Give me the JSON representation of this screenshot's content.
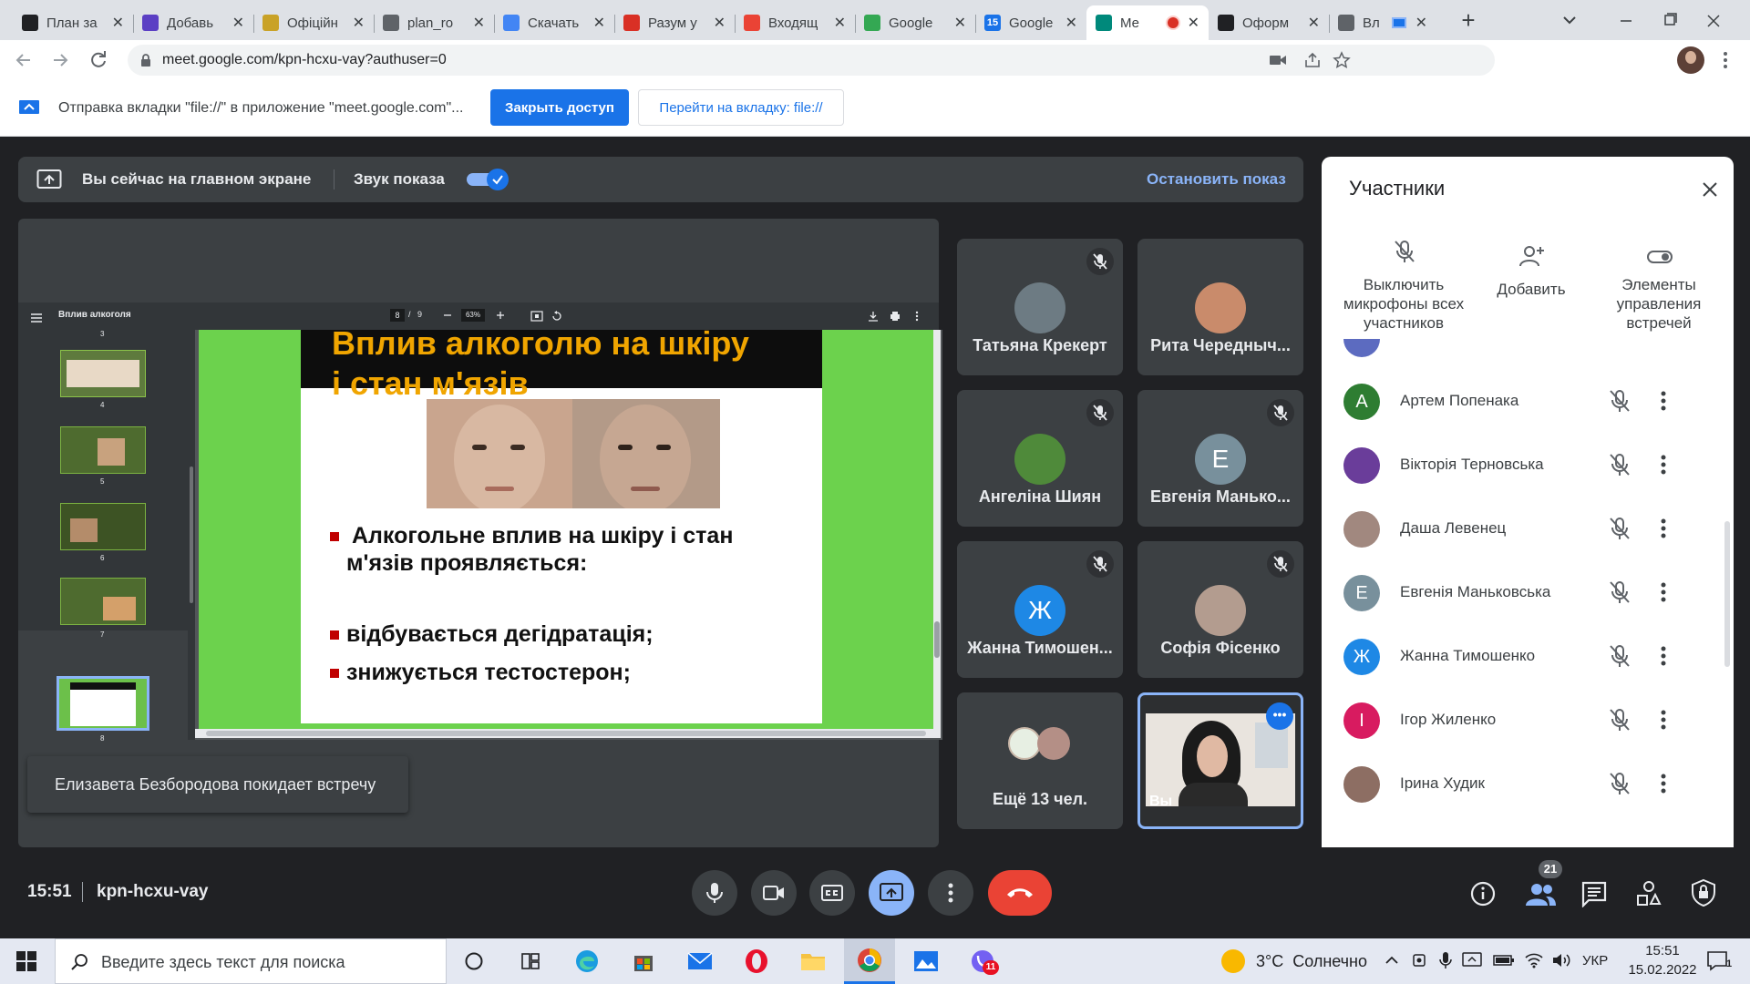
{
  "tabs": [
    {
      "title": "План за",
      "color": "#202124",
      "icon": "graduation-cap-icon"
    },
    {
      "title": "Добавь",
      "color": "#5b3fc4",
      "icon": "shield-icon"
    },
    {
      "title": "Офіційн",
      "color": "#c9a227",
      "icon": "coat-of-arms-icon"
    },
    {
      "title": "plan_ro",
      "color": "#5f6368",
      "icon": "globe-icon"
    },
    {
      "title": "Скачать",
      "color": "#4285f4",
      "icon": "download-icon"
    },
    {
      "title": "Разум у",
      "color": "#d93025",
      "icon": "bookmark-icon"
    },
    {
      "title": "Входящ",
      "color": "#ea4335",
      "icon": "gmail-icon"
    },
    {
      "title": "Google",
      "color": "#34a853",
      "icon": "google-classroom-icon"
    },
    {
      "title": "Google",
      "color": "#1a73e8",
      "icon": "calendar-icon"
    },
    {
      "title": "Ме",
      "color": "#00897b",
      "icon": "meet-icon"
    },
    {
      "title": "Оформ",
      "color": "#202124",
      "icon": "u-logo-icon"
    },
    {
      "title": "Вл",
      "color": "#5f6368",
      "icon": "globe-icon"
    }
  ],
  "calendar_badge": "15",
  "new_tab_glyph": "+",
  "url": "meet.google.com/kpn-hcxu-vay?authuser=0",
  "infobar": {
    "message": "Отправка вкладки \"file://\" в приложение \"meet.google.com\"...",
    "stop_label": "Закрыть доступ",
    "goto_label": "Перейти на вкладку: file://"
  },
  "present_bar": {
    "main_screen_text": "Вы сейчас на главном экране",
    "sound_label": "Звук показа",
    "sound_on": true,
    "stop_label": "Остановить показ"
  },
  "pdf": {
    "doc_title": "Вплив алкоголя",
    "page_current": "8",
    "page_sep": "/",
    "page_total": "9",
    "zoom": "63%",
    "thumb_numbers": [
      "3",
      "4",
      "5",
      "6",
      "7",
      "8"
    ],
    "slide_title_line1": "Вплив алкоголю  на шкіру",
    "slide_title_line2": "і стан м'язів",
    "bullet1_line1": "Алкогольне вплив на шкіру і стан",
    "bullet1_line2": "м'язів проявляється:",
    "bullet2": "відбувається дегідратація;",
    "bullet3": "знижується тестостерон;"
  },
  "toast": "Елизавета Безбородова покидает встречу",
  "tiles": [
    {
      "name": "Татьяна Крекерт",
      "muted": true,
      "avatar_color": "#6d7b83",
      "initial": ""
    },
    {
      "name": "Рита Чередныч...",
      "muted": false,
      "avatar_color": "#c98b6b",
      "initial": ""
    },
    {
      "name": "Ангеліна Шиян",
      "muted": true,
      "avatar_color": "#4f8a3a",
      "initial": ""
    },
    {
      "name": "Евгенія Манько...",
      "muted": true,
      "avatar_color": "#78909c",
      "initial": "Е"
    },
    {
      "name": "Жанна Тимошен...",
      "muted": true,
      "avatar_color": "#1e88e5",
      "initial": "Ж"
    },
    {
      "name": "Софія Фісенко",
      "muted": true,
      "avatar_color": "#b39c8f",
      "initial": ""
    },
    {
      "name": "Ещё 13 чел.",
      "muted": false,
      "avatar_color": "#5f6368",
      "initial": ""
    },
    {
      "name": "Вы",
      "muted": false,
      "avatar_color": "#3c3c3c",
      "initial": ""
    }
  ],
  "panel": {
    "title": "Участники",
    "actions": [
      {
        "label": "Выключить микрофоны всех участников",
        "icon": "mic-off-icon"
      },
      {
        "label": "Добавить",
        "icon": "add-person-icon"
      },
      {
        "label": "Элементы управления встречей",
        "icon": "toggle-icon"
      }
    ],
    "people": [
      {
        "name": "Артем Попенака",
        "initial": "А",
        "color": "#2e7d32"
      },
      {
        "name": "Вікторія Терновська",
        "initial": "",
        "color": "#6a3d9a"
      },
      {
        "name": "Даша Левенец",
        "initial": "",
        "color": "#a1887f"
      },
      {
        "name": "Евгенія Маньковська",
        "initial": "Е",
        "color": "#78909c"
      },
      {
        "name": "Жанна Тимошенко",
        "initial": "Ж",
        "color": "#1e88e5"
      },
      {
        "name": "Ігор Жиленко",
        "initial": "І",
        "color": "#d81b60"
      },
      {
        "name": "Ірина Худик",
        "initial": "",
        "color": "#8d6e63"
      }
    ]
  },
  "bottom": {
    "time": "15:51",
    "meeting_code": "kpn-hcxu-vay",
    "participants_count": "21"
  },
  "taskbar": {
    "search_placeholder": "Введите здесь текст для поиска",
    "weather": "3°C  Солнечно",
    "lang": "УКР",
    "time": "15:51",
    "date": "15.02.2022",
    "viber_badge": "11",
    "notif_count": "1"
  }
}
